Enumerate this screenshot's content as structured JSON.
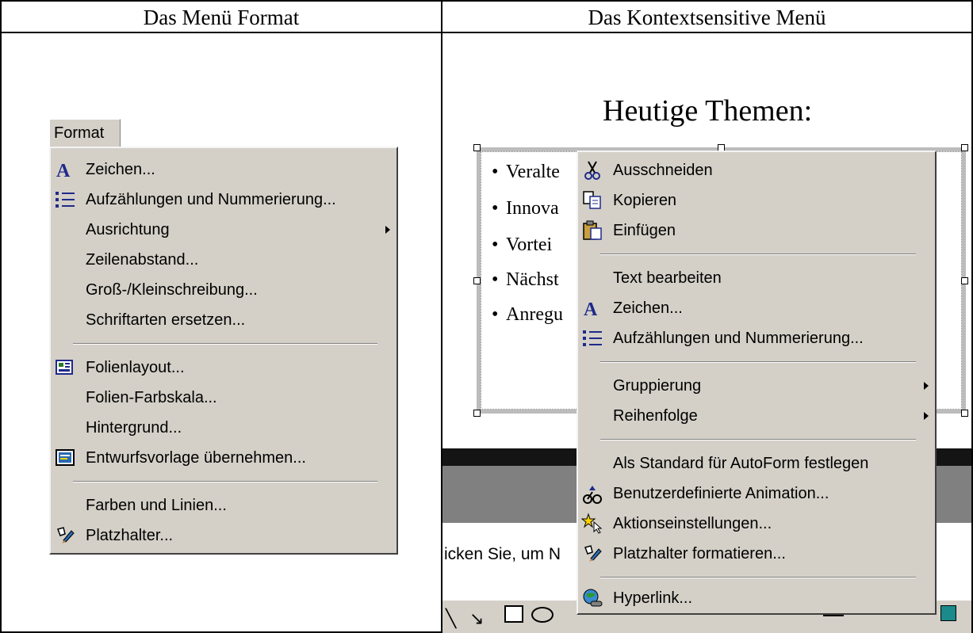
{
  "headers": {
    "left": "Das Menü Format",
    "right": "Das Kontextsensitive Menü"
  },
  "format_menu": {
    "menubar_label": "Format",
    "items": [
      {
        "label": "Zeichen...",
        "icon": "font-a-icon"
      },
      {
        "label": "Aufzählungen und Nummerierung...",
        "icon": "bullet-list-icon"
      },
      {
        "label": "Ausrichtung",
        "submenu": true
      },
      {
        "label": "Zeilenabstand..."
      },
      {
        "label": "Groß-/Kleinschreibung..."
      },
      {
        "label": "Schriftarten ersetzen..."
      },
      {
        "label": "Folienlayout...",
        "icon": "slide-layout-icon"
      },
      {
        "label": "Folien-Farbskala..."
      },
      {
        "label": "Hintergrund..."
      },
      {
        "label": "Entwurfsvorlage übernehmen...",
        "icon": "design-template-icon"
      },
      {
        "label": "Farben und Linien..."
      },
      {
        "label": "Platzhalter...",
        "icon": "placeholder-icon"
      }
    ]
  },
  "slide": {
    "title": "Heutige Themen:",
    "bullets": [
      "Veralte",
      "Innova",
      "Vortei",
      "Nächst",
      "Anregu"
    ],
    "notes_text": "icken Sie, um N"
  },
  "context_menu": {
    "items": [
      {
        "label": "Ausschneiden",
        "icon": "scissors-icon"
      },
      {
        "label": "Kopieren",
        "icon": "copy-icon"
      },
      {
        "label": "Einfügen",
        "icon": "paste-icon"
      },
      {
        "label": "Text bearbeiten"
      },
      {
        "label": "Zeichen...",
        "icon": "font-a-icon"
      },
      {
        "label": "Aufzählungen und Nummerierung...",
        "icon": "bullet-list-icon"
      },
      {
        "label": "Gruppierung",
        "submenu": true
      },
      {
        "label": "Reihenfolge",
        "submenu": true
      },
      {
        "label": "Als Standard für AutoForm festlegen"
      },
      {
        "label": "Benutzerdefinierte Animation...",
        "icon": "animation-icon"
      },
      {
        "label": "Aktionseinstellungen...",
        "icon": "action-settings-icon"
      },
      {
        "label": "Platzhalter formatieren...",
        "icon": "placeholder-icon"
      },
      {
        "label": "Hyperlink...",
        "icon": "hyperlink-globe-icon"
      }
    ]
  },
  "colors": {
    "menu_bg": "#d4d0c8",
    "font_a": "#1f2a8a",
    "list_blue": "#1f2a8a"
  }
}
